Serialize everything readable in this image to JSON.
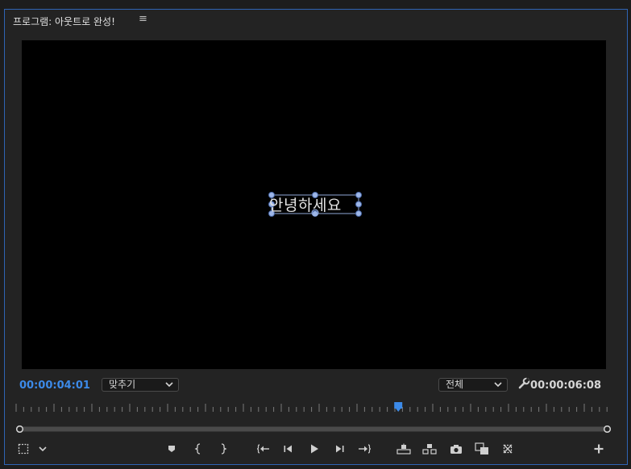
{
  "panel": {
    "title": "프로그램: 아웃트로 완성!",
    "menu_icon": "≡"
  },
  "viewer": {
    "caption_text": "안녕하세요"
  },
  "timecodes": {
    "current": "00:00:04:01",
    "duration": "00:00:06:08"
  },
  "zoom_select": {
    "value": "맞추기"
  },
  "resolution_select": {
    "value": "전체"
  },
  "playhead": {
    "position_fraction": 0.64
  },
  "colors": {
    "accent": "#3c8ae8",
    "panel_border": "#2f64b4",
    "viewer_bg": "#000000",
    "handle": "#9db6e8"
  },
  "icons": {
    "safe_margins": "safe-margins-icon",
    "chevron": "chevron-down-icon",
    "marker": "add-marker-icon",
    "mark_in": "mark-in-icon",
    "mark_out": "mark-out-icon",
    "go_to_in": "go-to-in-icon",
    "step_back": "step-back-icon",
    "play": "play-icon",
    "step_forward": "step-forward-icon",
    "go_to_out": "go-to-out-icon",
    "lift": "lift-icon",
    "extract": "extract-icon",
    "export_frame": "camera-icon",
    "compare": "compare-view-icon",
    "multicam": "multi-camera-icon",
    "add": "plus-icon",
    "settings": "wrench-icon"
  }
}
